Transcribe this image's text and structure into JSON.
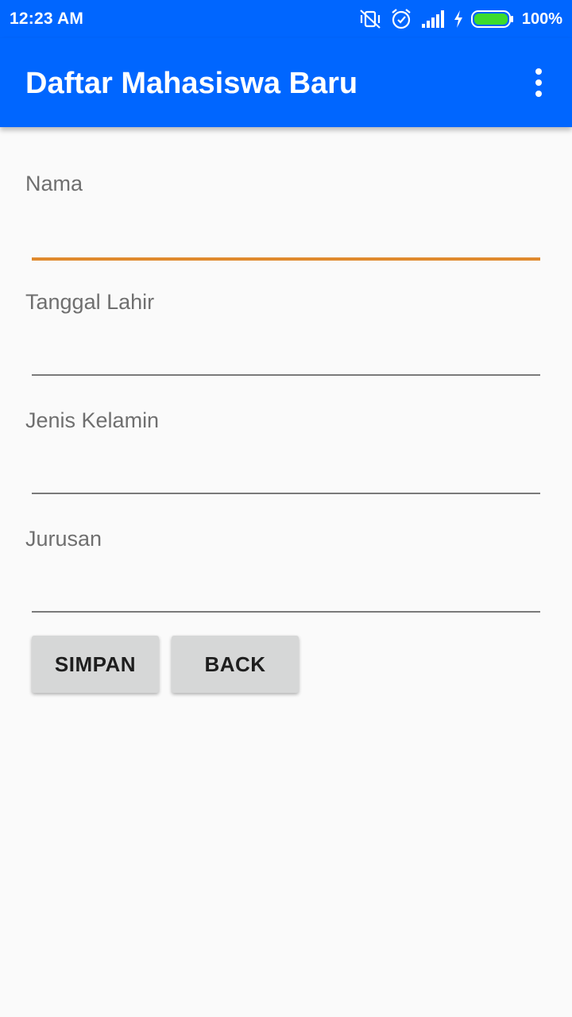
{
  "status_bar": {
    "time": "12:23 AM",
    "battery_percent": "100%",
    "icons": [
      "vibrate-off-icon",
      "alarm-icon",
      "signal-icon",
      "charging-icon",
      "battery-icon"
    ]
  },
  "app_bar": {
    "title": "Daftar Mahasiswa Baru",
    "overflow_icon": "more-vert-icon"
  },
  "form": {
    "fields": [
      {
        "label": "Nama",
        "value": "",
        "focused": true
      },
      {
        "label": "Tanggal Lahir",
        "value": "",
        "focused": false
      },
      {
        "label": "Jenis Kelamin",
        "value": "",
        "focused": false
      },
      {
        "label": "Jurusan",
        "value": "",
        "focused": false
      }
    ]
  },
  "buttons": {
    "save_label": "SIMPAN",
    "back_label": "BACK"
  },
  "colors": {
    "primary": "#0066ff",
    "accent": "#e08a2e",
    "background": "#fafafa",
    "button": "#d6d7d7"
  }
}
